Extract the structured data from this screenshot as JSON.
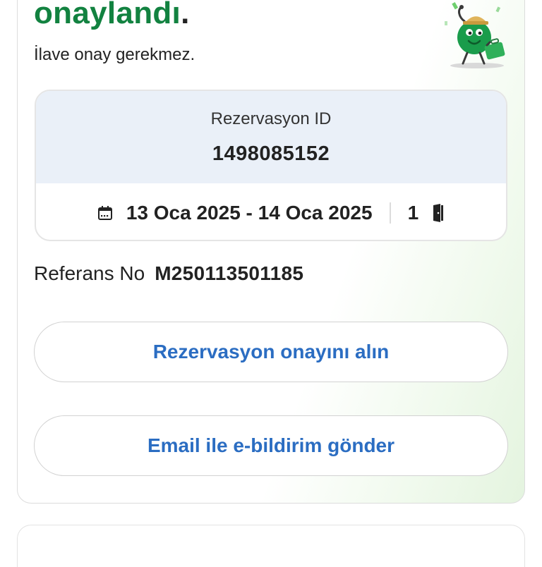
{
  "confirmation": {
    "title": "onaylandı",
    "title_dot": ".",
    "subtitle": "İlave onay gerekmez."
  },
  "booking": {
    "id_label": "Rezervasyon ID",
    "id_value": "1498085152",
    "dates": "13 Oca 2025 - 14 Oca 2025",
    "rooms": "1"
  },
  "reference": {
    "label": "Referans No",
    "value": "M250113501185"
  },
  "actions": {
    "get_confirmation": "Rezervasyon onayını alın",
    "send_email": "Email ile e-bildirim gönder"
  },
  "colors": {
    "title_green": "#128240",
    "link_blue": "#2b6dc2",
    "booking_header_bg": "#eaf0f8"
  },
  "icons": [
    "calendar-icon",
    "door-icon",
    "mascot-illustration"
  ]
}
